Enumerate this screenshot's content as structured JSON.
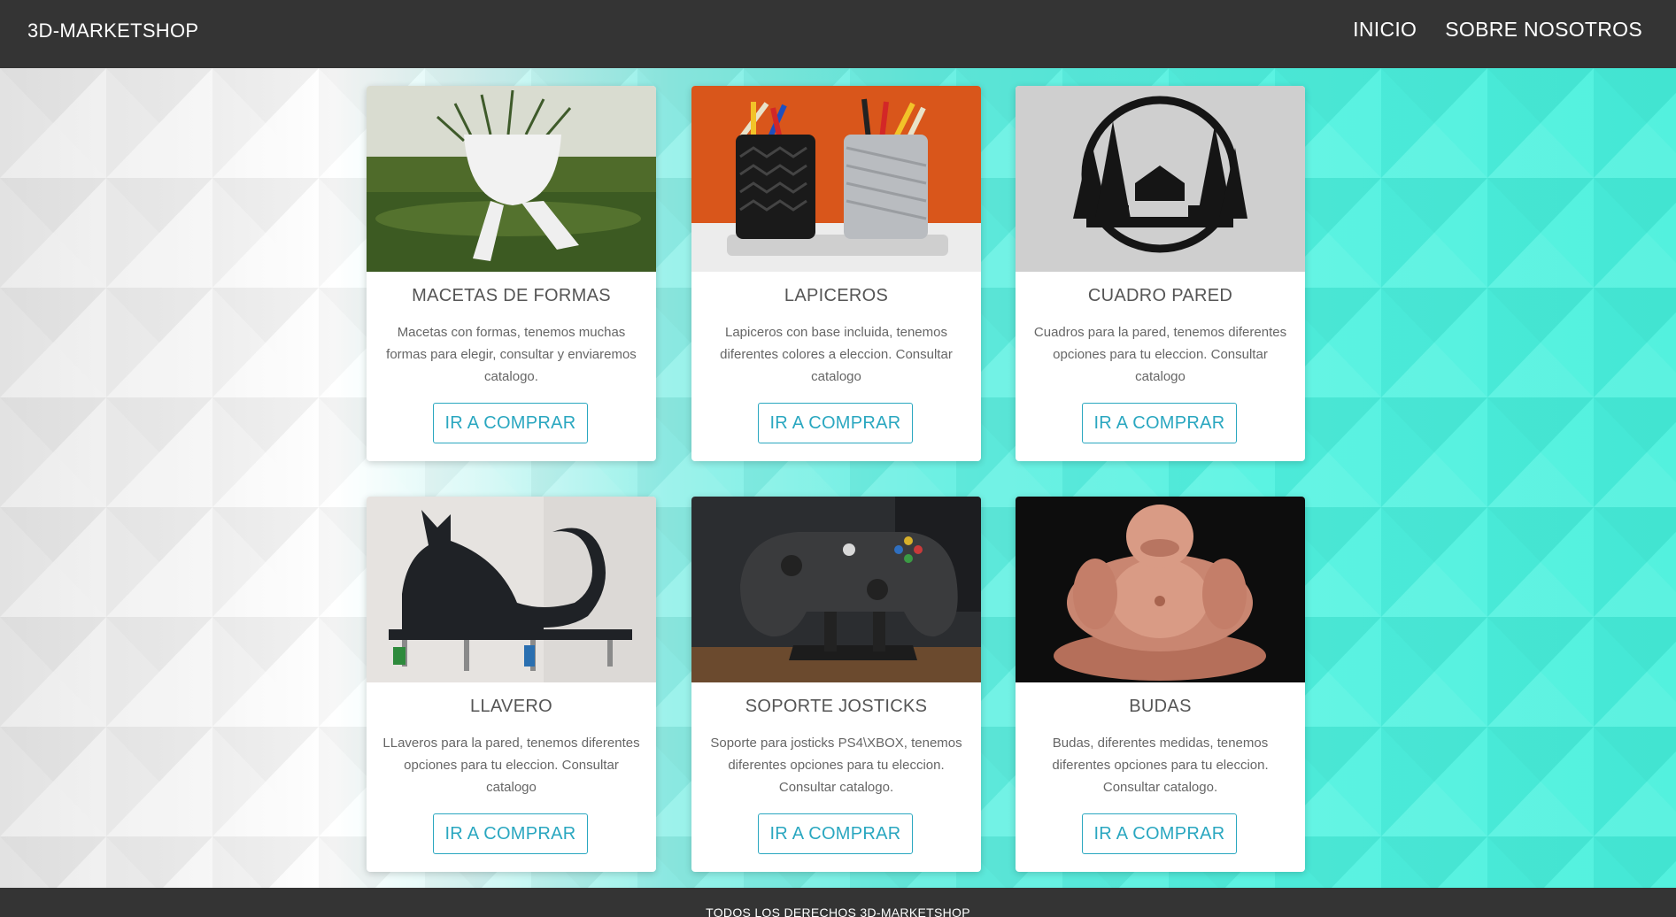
{
  "navbar": {
    "brand": "3D-MARKETSHOP",
    "links": [
      "INICIO",
      "SOBRE NOSOTROS"
    ]
  },
  "products": [
    {
      "title": "MACETAS DE FORMAS",
      "description": "Macetas con formas, tenemos muchas formas para elegir, consultar y enviaremos catalogo.",
      "button_label": "IR A COMPRAR"
    },
    {
      "title": "LAPICEROS",
      "description": "Lapiceros con base incluida, tenemos diferentes colores a eleccion. Consultar catalogo",
      "button_label": "IR A COMPRAR"
    },
    {
      "title": "CUADRO PARED",
      "description": "Cuadros para la pared, tenemos diferentes opciones para tu eleccion. Consultar catalogo",
      "button_label": "IR A COMPRAR"
    },
    {
      "title": "LLAVERO",
      "description": "LLaveros para la pared, tenemos diferentes opciones para tu eleccion. Consultar catalogo",
      "button_label": "IR A COMPRAR"
    },
    {
      "title": "SOPORTE JOSTICKS",
      "description": "Soporte para josticks PS4\\XBOX, tenemos diferentes opciones para tu eleccion. Consultar catalogo.",
      "button_label": "IR A COMPRAR"
    },
    {
      "title": "BUDAS",
      "description": "Budas, diferentes medidas, tenemos diferentes opciones para tu eleccion. Consultar catalogo.",
      "button_label": "IR A COMPRAR"
    }
  ],
  "footer": {
    "text": "TODOS LOS DERECHOS 3D-MARKETSHOP"
  },
  "colors": {
    "navbar": "#343434",
    "button_accent": "#2aa7c0",
    "background_teal": "#4ff2e0"
  }
}
